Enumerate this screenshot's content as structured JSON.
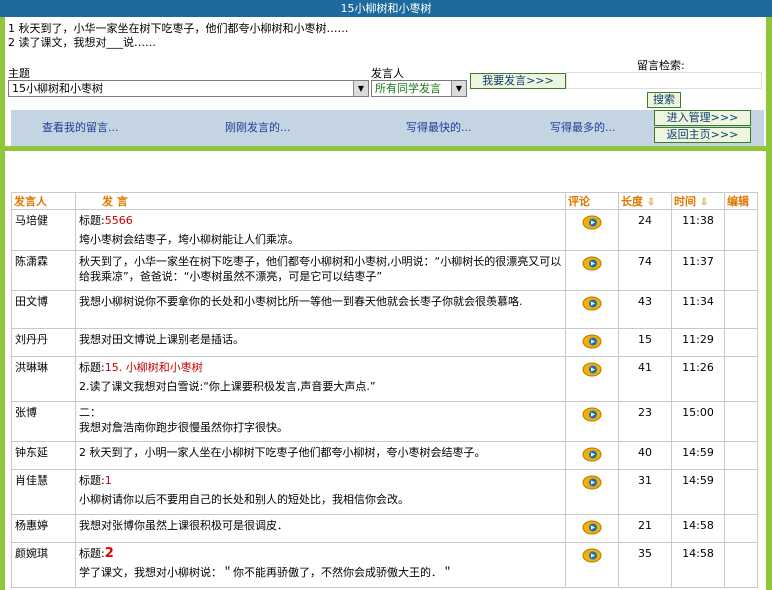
{
  "window": {
    "title": "15小柳树和小枣树"
  },
  "topic_lines": [
    "1 秋天到了，小华一家坐在树下吃枣子，他们都夸小柳树和小枣树……",
    "2 读了课文，我想对___说……"
  ],
  "filters": {
    "subject_label": "主题",
    "subject_value": "15小柳树和小枣树",
    "poster_label": "发言人",
    "poster_value": "所有同学发言",
    "post_button": "我要发言>>>",
    "search_label": "留言检索:",
    "search_value": "",
    "search_button": "搜索"
  },
  "nav": {
    "my_posts": "查看我的留言...",
    "latest": "刚刚发言的...",
    "fastest": "写得最快的...",
    "longest": "写得最多的...",
    "admin": "进入管理>>>",
    "home": "返回主页>>>"
  },
  "table": {
    "headers": {
      "author": "发言人",
      "content": "发  言",
      "comment": "评论",
      "length": "长度",
      "time": "时间",
      "edit": "编辑"
    },
    "rows": [
      {
        "author": "马培健",
        "title_label": "标题:",
        "title": "5566",
        "title_style": "small",
        "text": "垮小枣树会结枣子，垮小柳树能让人们乘凉。",
        "length": "24",
        "time": "11:38"
      },
      {
        "author": "陈潇霖",
        "title_label": "",
        "title": "",
        "title_style": "",
        "text": "秋天到了，小华一家坐在树下吃枣子，他们都夸小柳树和小枣树,小明说：“小柳树长的很漂亮又可以给我乘凉”，爸爸说：“小枣树虽然不漂亮，可是它可以结枣子”",
        "length": "74",
        "time": "11:37"
      },
      {
        "author": "田文博",
        "title_label": "",
        "title": "",
        "title_style": "",
        "text": "我想小柳树说你不要拿你的长处和小枣树比所一等他一到春天他就会长枣子你就会很羡慕咯.",
        "length": "43",
        "time": "11:34"
      },
      {
        "author": "刘丹丹",
        "title_label": "",
        "title": "",
        "title_style": "",
        "text": "我想对田文博说上课别老是插话。",
        "length": "15",
        "time": "11:29"
      },
      {
        "author": "洪琳琳",
        "title_label": "标题:",
        "title": "15. 小柳树和小枣树",
        "title_style": "small",
        "text": "2.读了课文我想对白雪说:“你上课要积极发言,声音要大声点.”",
        "length": "41",
        "time": "11:26"
      },
      {
        "author": "张博",
        "title_label": "",
        "title": "",
        "title_style": "",
        "text": "二：\n我想对詹浩南你跑步很慢虽然你打字很快。",
        "length": "23",
        "time": "15:00"
      },
      {
        "author": "钟东延",
        "title_label": "",
        "title": "",
        "title_style": "",
        "text": "2 秋天到了，小明一家人坐在小柳树下吃枣子他们都夸小柳树，夸小枣树会结枣子。",
        "length": "40",
        "time": "14:59"
      },
      {
        "author": "肖佳慧",
        "title_label": "标题:",
        "title": "1",
        "title_style": "small",
        "text": "小柳树请你以后不要用自己的长处和别人的短处比，我相信你会改。",
        "length": "31",
        "time": "14:59"
      },
      {
        "author": "杨惠婷",
        "title_label": "",
        "title": "",
        "title_style": "",
        "text": "我想对张博你虽然上课很积极可是很调皮．",
        "length": "21",
        "time": "14:58"
      },
      {
        "author": "颜婉琪",
        "title_label": "标题:",
        "title": "2",
        "title_style": "big",
        "text": "学了课文，我想对小柳树说：＂你不能再骄傲了，不然你会成骄傲大王的．＂",
        "length": "35",
        "time": "14:58"
      }
    ]
  }
}
